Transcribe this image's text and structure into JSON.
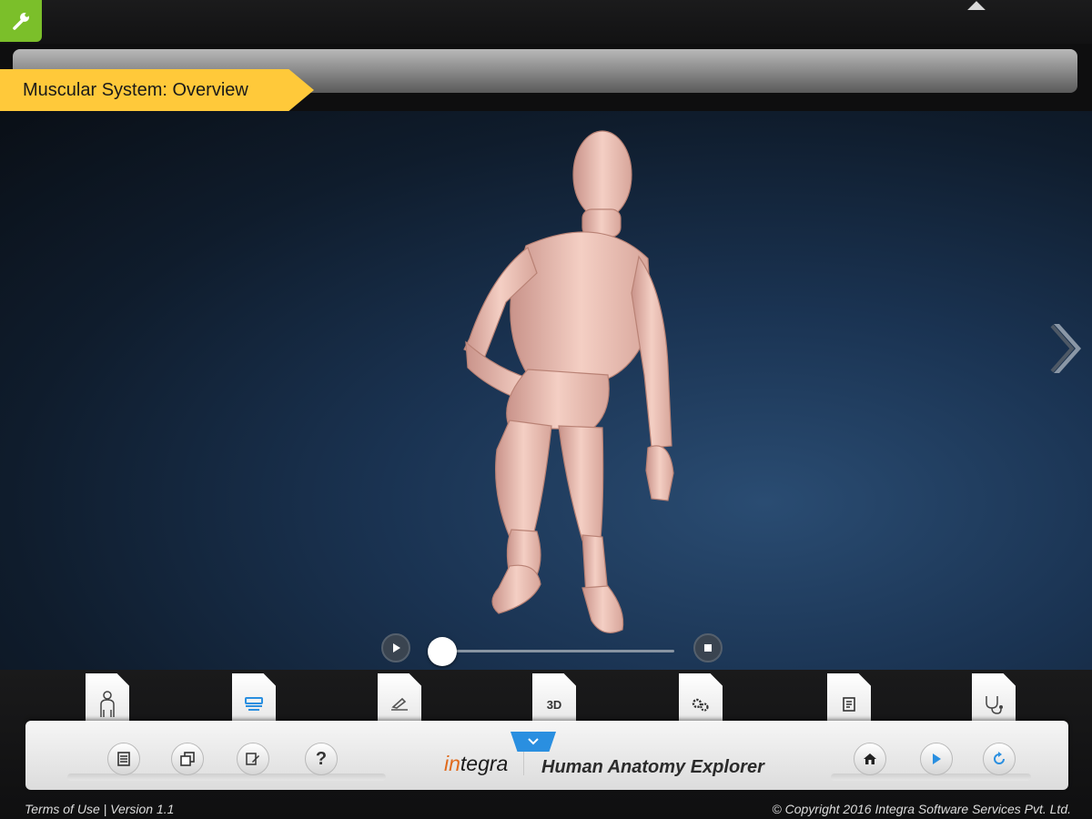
{
  "header": {
    "title": "Muscular System: Overview",
    "tools_icon": "wrench-icon"
  },
  "viewer": {
    "next_icon": "chevron-right-icon",
    "player": {
      "play_icon": "play-icon",
      "stop_icon": "stop-icon",
      "progress": 0.0
    }
  },
  "tabs": [
    {
      "name": "body-tab",
      "icon": "human-figure-icon",
      "label": ""
    },
    {
      "name": "layers-tab",
      "icon": "layers-icon",
      "label": ""
    },
    {
      "name": "notes-tab",
      "icon": "notes-icon",
      "label": ""
    },
    {
      "name": "view-3d-tab",
      "icon": "",
      "label": "3D"
    },
    {
      "name": "settings-tab",
      "icon": "gears-icon",
      "label": ""
    },
    {
      "name": "info-tab",
      "icon": "document-icon",
      "label": ""
    },
    {
      "name": "diagnose-tab",
      "icon": "stethoscope-icon",
      "label": ""
    }
  ],
  "toolbar": {
    "left_buttons": [
      {
        "name": "menu-button",
        "icon": "list-icon"
      },
      {
        "name": "copy-button",
        "icon": "copy-icon"
      },
      {
        "name": "edit-notes-button",
        "icon": "edit-icon"
      },
      {
        "name": "help-button",
        "icon": "question-icon",
        "label": "?"
      }
    ],
    "right_buttons": [
      {
        "name": "home-button",
        "icon": "home-icon"
      },
      {
        "name": "play-button",
        "icon": "play-icon"
      },
      {
        "name": "reload-button",
        "icon": "reload-icon"
      }
    ],
    "logo": {
      "brand_accent": "in",
      "brand_rest": "tegra"
    },
    "app_name": "Human Anatomy Explorer",
    "toggle_icon": "chevron-down-icon"
  },
  "footer": {
    "left": "Terms of Use |  Version 1.1",
    "right": "© Copyright 2016 Integra Software Services Pvt. Ltd."
  },
  "colors": {
    "accent_yellow": "#ffc93a",
    "wrench_green": "#7bbf2a",
    "button_blue": "#2a8fe0"
  }
}
